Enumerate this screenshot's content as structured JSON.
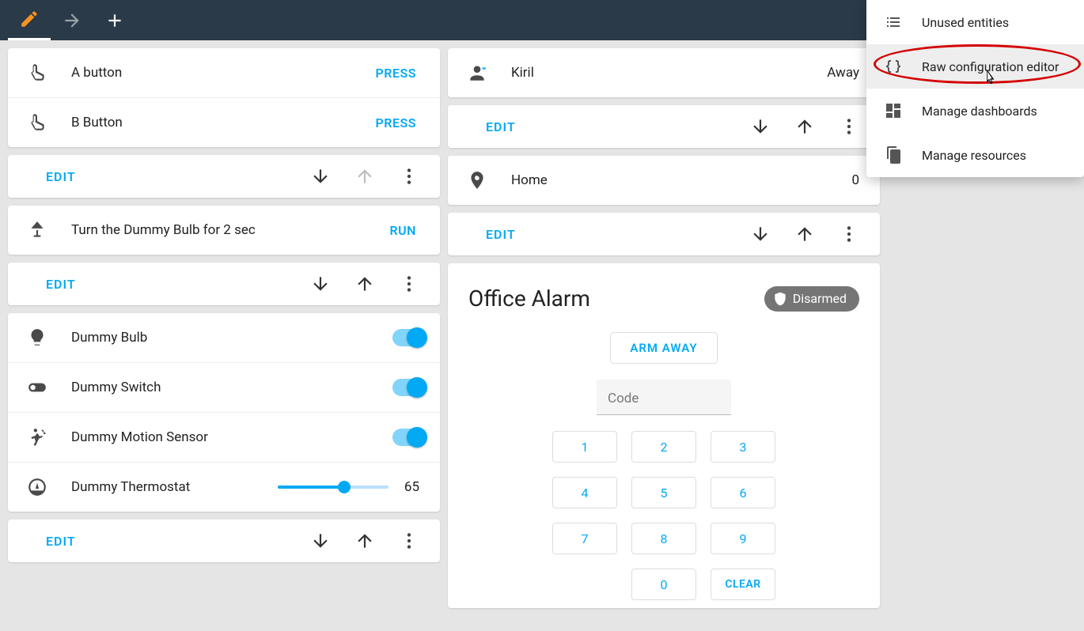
{
  "header": {
    "tabs": [
      "edit",
      "arrow",
      "add"
    ]
  },
  "menu": {
    "items": [
      {
        "label": "Unused entities",
        "icon": "list-icon"
      },
      {
        "label": "Raw configuration editor",
        "icon": "braces-icon",
        "highlighted": true
      },
      {
        "label": "Manage dashboards",
        "icon": "dashboard-icon"
      },
      {
        "label": "Manage resources",
        "icon": "copy-icon"
      }
    ]
  },
  "left": {
    "buttons_card": {
      "items": [
        {
          "label": "A button",
          "action": "PRESS"
        },
        {
          "label": "B Button",
          "action": "PRESS"
        }
      ]
    },
    "script_card": {
      "items": [
        {
          "label": "Turn the Dummy Bulb for 2 sec",
          "action": "RUN"
        }
      ]
    },
    "entities_card": {
      "items": [
        {
          "label": "Dummy Bulb",
          "type": "toggle",
          "value": true
        },
        {
          "label": "Dummy Switch",
          "type": "toggle",
          "value": true
        },
        {
          "label": "Dummy Motion Sensor",
          "type": "toggle",
          "value": true
        },
        {
          "label": "Dummy Thermostat",
          "type": "slider",
          "value": 65
        }
      ]
    },
    "edit_label": "EDIT"
  },
  "right": {
    "person_card": {
      "name": "Kiril",
      "state": "Away"
    },
    "zone_card": {
      "name": "Home",
      "value": "0"
    },
    "alarm_card": {
      "title": "Office Alarm",
      "badge": "Disarmed",
      "arm_label": "ARM AWAY",
      "code_placeholder": "Code",
      "keys": [
        "1",
        "2",
        "3",
        "4",
        "5",
        "6",
        "7",
        "8",
        "9",
        "0",
        "CLEAR"
      ]
    },
    "edit_label": "EDIT"
  }
}
